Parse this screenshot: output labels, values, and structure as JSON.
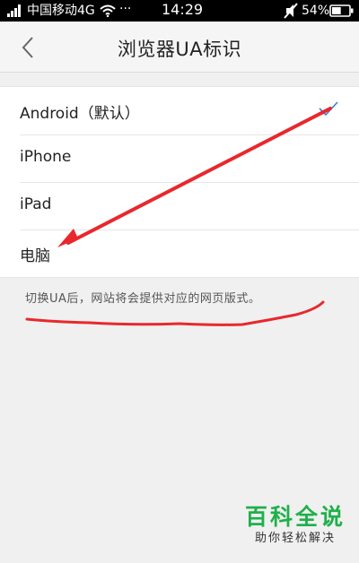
{
  "status_bar": {
    "carrier": "中国移动4G",
    "dots": "···",
    "time": "14:29",
    "battery_percent": "54%",
    "battery_level": 0.54,
    "icons": [
      "signal-icon",
      "wifi-icon",
      "mute-icon",
      "battery-icon"
    ]
  },
  "header": {
    "title": "浏览器UA标识",
    "back_icon": "chevron-left-icon"
  },
  "options": [
    {
      "label": "Android（默认）",
      "selected": true
    },
    {
      "label": "iPhone",
      "selected": false
    },
    {
      "label": "iPad",
      "selected": false
    },
    {
      "label": "电脑",
      "selected": false
    }
  ],
  "hint": "切换UA后，网站将会提供对应的网页版式。",
  "watermark": {
    "title": "百科全说",
    "subtitle": "助你轻松解决"
  },
  "colors": {
    "check": "#3a7fd5",
    "annotation": "#e8282d",
    "watermark_green": "#1fb04a"
  }
}
